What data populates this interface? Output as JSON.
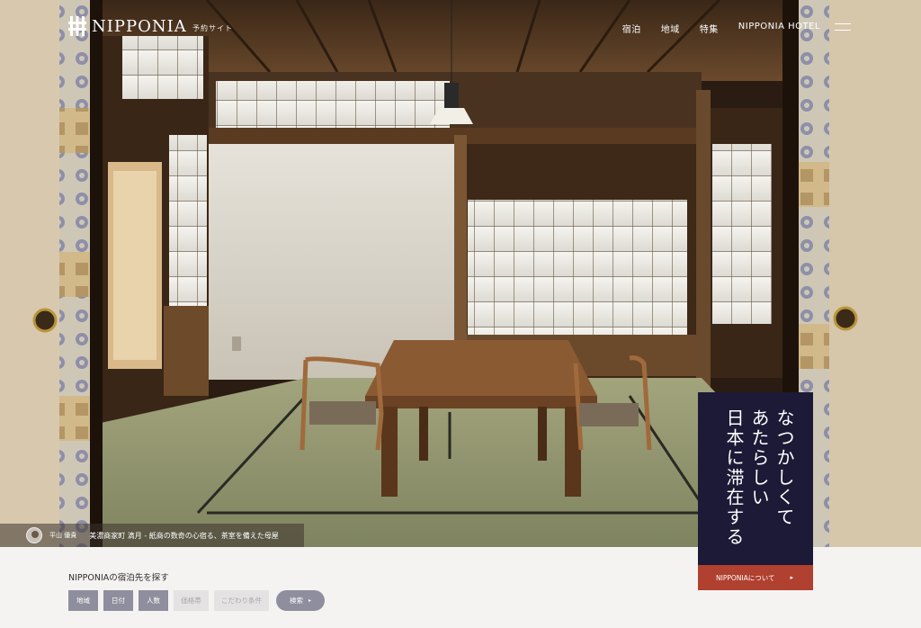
{
  "header": {
    "logo_text": "NIPPONIA",
    "logo_sub": "予約サイト",
    "nav": [
      "宿泊",
      "地域",
      "特集",
      "NIPPONIA HOTEL"
    ]
  },
  "icons": {
    "logo": "logo-mark-icon",
    "menu": "hamburger-menu-icon",
    "arrow": "chevron-right-icon"
  },
  "hero": {
    "photographer": "平山 優貴",
    "caption": "美濃商家町 滴月 - 紙商の数奇の心宿る、茶室を備えた母屋"
  },
  "panel": {
    "tagline": "なつかしくて\nあたらしい\n日本に滞在する",
    "about_label": "NIPPONIAについて"
  },
  "search": {
    "title": "NIPPONIAの宿泊先を探す",
    "filters": [
      "地域",
      "日付",
      "人数",
      "価格帯",
      "こだわり条件"
    ],
    "button_label": "検索"
  },
  "colors": {
    "panel": "#1c1a36",
    "accent_red": "#b0402f",
    "filter_active": "#8f8e9e",
    "filter_disabled": "#e4e2e2"
  }
}
